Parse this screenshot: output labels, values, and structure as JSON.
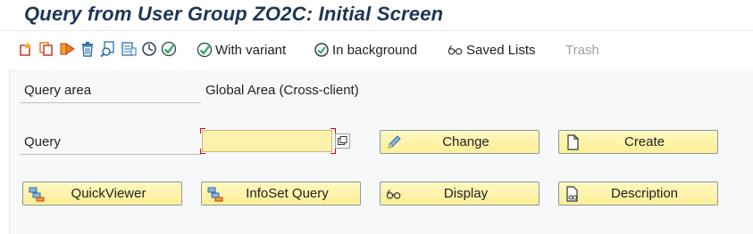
{
  "window": {
    "title": "Query from User Group ZO2C: Initial Screen"
  },
  "toolbar": {
    "icons": [
      "create-icon",
      "copy-icon",
      "execute-icon",
      "delete-icon",
      "display-icon",
      "description-icon",
      "execute-with-variant-icon",
      "check-icon"
    ],
    "with_variant": "With variant",
    "in_background": "In background",
    "saved_lists": "Saved Lists",
    "trash": "Trash"
  },
  "form": {
    "query_area_label": "Query area",
    "query_area_value": "Global Area (Cross-client)",
    "query_label": "Query",
    "query_value": "",
    "query_placeholder": ""
  },
  "buttons": {
    "change": "Change",
    "create": "Create",
    "quickviewer": "QuickViewer",
    "infoset_query": "InfoSet Query",
    "display": "Display",
    "description": "Description"
  },
  "colors": {
    "title": "#1d3557",
    "button_bg": "#fcef95",
    "input_bg": "#fdf2ad",
    "required_marker": "#d0021b",
    "disabled_text": "#9aa0a6"
  }
}
